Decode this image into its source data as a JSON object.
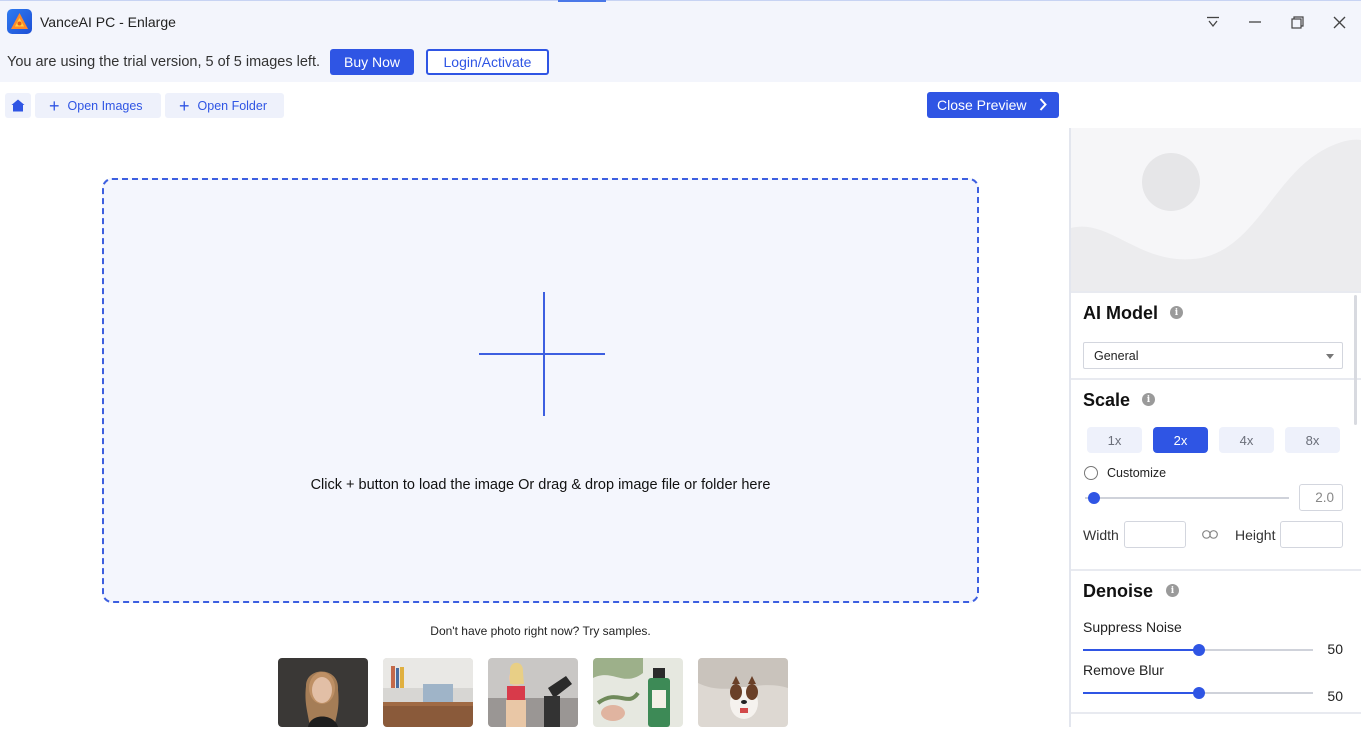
{
  "window": {
    "title": "VanceAI PC - Enlarge",
    "accent": "#2f55e4"
  },
  "trial": {
    "message": "You are using the trial version, 5 of 5 images left.",
    "buy_label": "Buy Now",
    "login_label": "Login/Activate"
  },
  "toolbar": {
    "open_images_label": "Open Images",
    "open_folder_label": "Open Folder",
    "close_preview_label": "Close Preview"
  },
  "dropzone": {
    "hint": "Click + button to load the image Or drag & drop image file or folder here"
  },
  "samples": {
    "hint": "Don't have photo right now? Try samples.",
    "items": [
      "sample-portrait",
      "sample-desk",
      "sample-fitness",
      "sample-cosmetics",
      "sample-dog"
    ]
  },
  "panel": {
    "ai_model": {
      "title": "AI Model",
      "selected": "General"
    },
    "scale": {
      "title": "Scale",
      "options": [
        "1x",
        "2x",
        "4x",
        "8x"
      ],
      "selected": "2x",
      "customize_label": "Customize",
      "custom_value": "2.0",
      "width_label": "Width",
      "height_label": "Height"
    },
    "denoise": {
      "title": "Denoise",
      "suppress_noise_label": "Suppress Noise",
      "suppress_noise_value": "50",
      "remove_blur_label": "Remove Blur",
      "remove_blur_value": "50"
    }
  }
}
